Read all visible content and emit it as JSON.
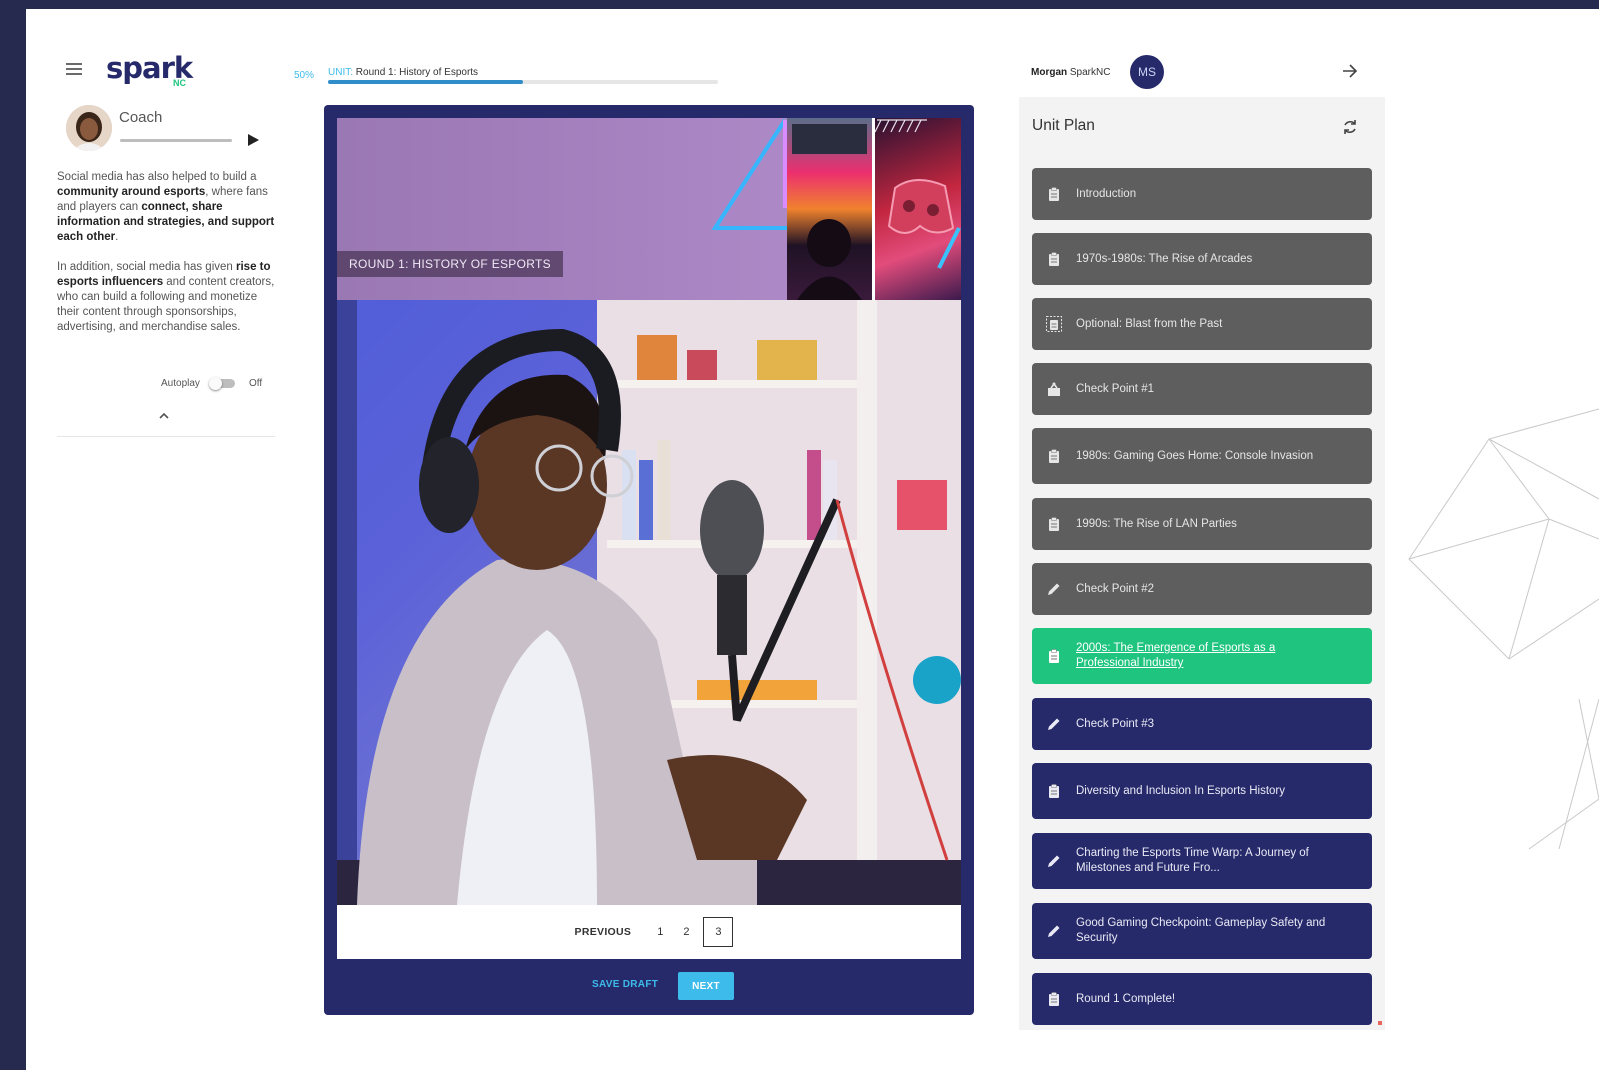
{
  "header": {
    "logo_main": "spark",
    "logo_sub": "NC",
    "progress_percent_label": "50%",
    "progress_unit_prefix": "UNIT:",
    "progress_unit_title": "Round 1: History of Esports",
    "progress_fraction": 0.5,
    "user_first": "Morgan",
    "user_last": "SparkNC",
    "user_initials": "MS"
  },
  "coach": {
    "label": "Coach",
    "autoplay_label": "Autoplay",
    "autoplay_state": "Off",
    "paragraphs": [
      [
        {
          "t": "Social media has also helped to build a ",
          "b": false
        },
        {
          "t": "community around esports",
          "b": true
        },
        {
          "t": ", where fans and players can ",
          "b": false
        },
        {
          "t": "connect, share information and strategies, and support each other",
          "b": true
        },
        {
          "t": ".",
          "b": false
        }
      ],
      [
        {
          "t": "In addition, social media has given ",
          "b": false
        },
        {
          "t": "rise to esports influencers",
          "b": true
        },
        {
          "t": " and content creators, who can build a following and monetize their content through sponsorships, advertising, and merchandise sales.",
          "b": false
        }
      ]
    ]
  },
  "content": {
    "banner_title": "ROUND 1: HISTORY OF ESPORTS",
    "pager": {
      "previous_label": "PREVIOUS",
      "pages": [
        "1",
        "2",
        "3"
      ],
      "current_page": "3"
    },
    "save_draft_label": "SAVE DRAFT",
    "next_label": "NEXT"
  },
  "unit_plan": {
    "title": "Unit Plan",
    "colors": {
      "done": "#5e5e5e",
      "active": "#1fc47f",
      "todo": "#262a6b"
    },
    "items": [
      {
        "label": "Introduction",
        "icon": "clipboard-icon",
        "status": "done"
      },
      {
        "label": "1970s-1980s: The Rise of Arcades",
        "icon": "clipboard-icon",
        "status": "done"
      },
      {
        "label": "Optional: Blast from the Past",
        "icon": "optional-clipboard-icon",
        "status": "done"
      },
      {
        "label": "Check Point #1",
        "icon": "quiz-icon",
        "status": "done"
      },
      {
        "label": "1980s: Gaming Goes Home: Console Invasion",
        "icon": "clipboard-icon",
        "status": "done"
      },
      {
        "label": "1990s: The Rise of LAN Parties",
        "icon": "clipboard-icon",
        "status": "done"
      },
      {
        "label": "Check Point #2",
        "icon": "pencil-icon",
        "status": "done"
      },
      {
        "label": "2000s: The Emergence of Esports as a Professional Industry",
        "icon": "clipboard-icon",
        "status": "active"
      },
      {
        "label": "Check Point #3",
        "icon": "pencil-icon",
        "status": "todo"
      },
      {
        "label": "Diversity and Inclusion In Esports History",
        "icon": "clipboard-icon",
        "status": "todo"
      },
      {
        "label": "Charting the Esports Time Warp: A Journey of Milestones and Future Fro...",
        "icon": "pencil-icon",
        "status": "todo"
      },
      {
        "label": "Good Gaming Checkpoint: Gameplay Safety and Security",
        "icon": "pencil-icon",
        "status": "todo"
      },
      {
        "label": "Round 1 Complete!",
        "icon": "clipboard-icon",
        "status": "todo"
      }
    ]
  }
}
